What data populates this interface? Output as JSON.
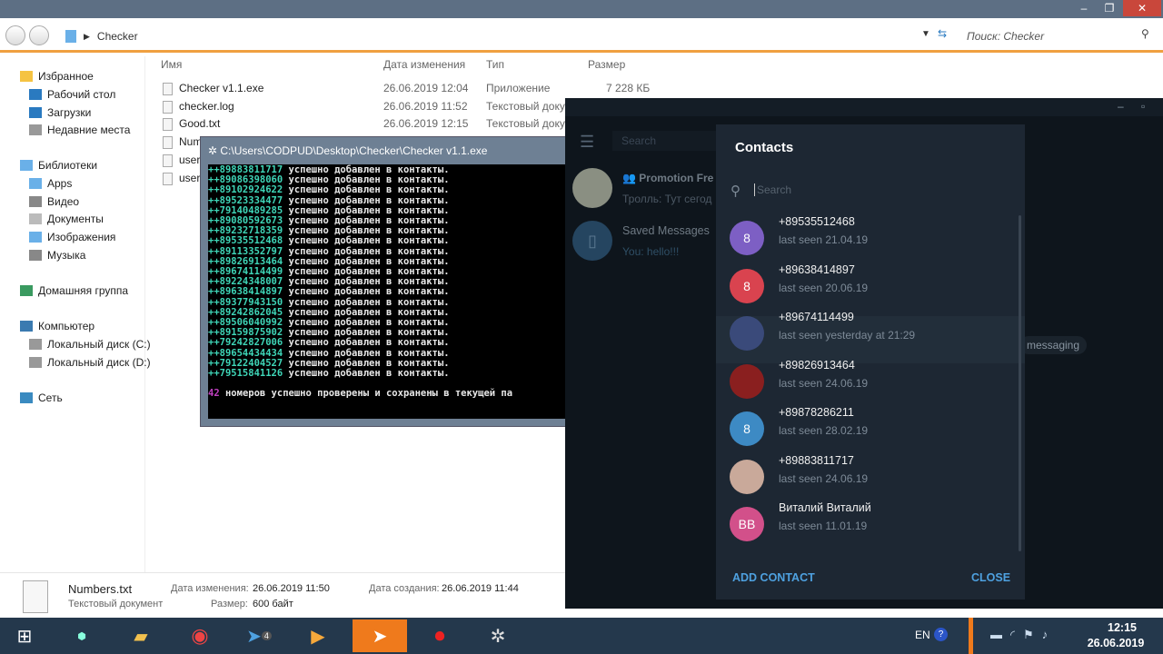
{
  "explorer": {
    "breadcrumb": "Checker",
    "search_placeholder": "Поиск: Checker",
    "sidebar": [
      {
        "label": "Избранное",
        "icon": "star-icon"
      },
      {
        "label": "Рабочий стол",
        "icon": "desktop-icon"
      },
      {
        "label": "Загрузки",
        "icon": "download-icon"
      },
      {
        "label": "Недавние места",
        "icon": "recent-icon"
      },
      {
        "label": "Библиотеки",
        "icon": "library-icon"
      },
      {
        "label": "Apps",
        "icon": "folder-icon"
      },
      {
        "label": "Видео",
        "icon": "video-icon"
      },
      {
        "label": "Документы",
        "icon": "documents-icon"
      },
      {
        "label": "Изображения",
        "icon": "images-icon"
      },
      {
        "label": "Музыка",
        "icon": "music-icon"
      },
      {
        "label": "Домашняя группа",
        "icon": "homegroup-icon"
      },
      {
        "label": "Компьютер",
        "icon": "computer-icon"
      },
      {
        "label": "Локальный диск (C:)",
        "icon": "drive-icon"
      },
      {
        "label": "Локальный диск (D:)",
        "icon": "drive-icon"
      },
      {
        "label": "Сеть",
        "icon": "network-icon"
      }
    ],
    "columns": [
      "Имя",
      "Дата изменения",
      "Тип",
      "Размер"
    ],
    "files": [
      {
        "name": "Checker v1.1.exe",
        "date": "26.06.2019 12:04",
        "type": "Приложение",
        "size": "7 228 КБ"
      },
      {
        "name": "checker.log",
        "date": "26.06.2019 11:52",
        "type": "Текстовый докум",
        "size": ""
      },
      {
        "name": "Good.txt",
        "date": "26.06.2019 12:15",
        "type": "Текстовый докум",
        "size": ""
      },
      {
        "name": "Num",
        "date": "",
        "type": "",
        "size": ""
      },
      {
        "name": "user.",
        "date": "",
        "type": "",
        "size": ""
      },
      {
        "name": "user.",
        "date": "",
        "type": "",
        "size": ""
      }
    ],
    "details": {
      "name": "Numbers.txt",
      "type": "Текстовый документ",
      "modified_label": "Дата изменения:",
      "modified": "26.06.2019 11:50",
      "size_label": "Размер:",
      "size": "600 байт",
      "created_label": "Дата создания:",
      "created": "26.06.2019 11:44"
    }
  },
  "console": {
    "title": "C:\\Users\\CODPUD\\Desktop\\Checker\\Checker v1.1.exe",
    "message": "успешно добавлен в контакты.",
    "numbers": [
      "++89883811717",
      "++89086398060",
      "++89102924622",
      "++89523334477",
      "++79140489285",
      "++89080592673",
      "++89232718359",
      "++89535512468",
      "++89113352797",
      "++89826913464",
      "++89674114499",
      "++89224348007",
      "++89638414897",
      "++89377943150",
      "++89242862045",
      "++89506040992",
      "++89159875902",
      "++79242827006",
      "++89654434434",
      "++79122404527",
      "++79515841126"
    ],
    "summary_count": "42",
    "summary_text": "номеров успешно проверены и сохранены в текущей па"
  },
  "telegram": {
    "search_placeholder": "Search",
    "chats": [
      {
        "name": "Promotion Fre",
        "preview": "Тролль: Тут сегод"
      },
      {
        "name": "Saved Messages",
        "preview": "You: hello!!!"
      }
    ],
    "background_hint": "messaging",
    "contacts": {
      "title": "Contacts",
      "search_placeholder": "Search",
      "add_label": "ADD CONTACT",
      "close_label": "CLOSE",
      "items": [
        {
          "name": "+89535512468",
          "seen": "last seen 21.04.19",
          "initials": "8",
          "color": "#7d5fc4"
        },
        {
          "name": "+89638414897",
          "seen": "last seen 20.06.19",
          "initials": "8",
          "color": "#d9434f"
        },
        {
          "name": "+89674114499",
          "seen": "last seen yesterday at 21:29",
          "initials": "",
          "color": "#3a4a7a"
        },
        {
          "name": "+89826913464",
          "seen": "last seen 24.06.19",
          "initials": "",
          "color": "#8a1f1f"
        },
        {
          "name": "+89878286211",
          "seen": "last seen 28.02.19",
          "initials": "8",
          "color": "#3d8ac4"
        },
        {
          "name": "+89883811717",
          "seen": "last seen 24.06.19",
          "initials": "",
          "color": "#c9a99a"
        },
        {
          "name": "Виталий Виталий",
          "seen": "last seen 11.01.19",
          "initials": "BB",
          "color": "#d2508a"
        }
      ]
    }
  },
  "taskbar": {
    "lang": "EN",
    "time": "12:15",
    "date": "26.06.2019",
    "telegram_badge": "4"
  }
}
